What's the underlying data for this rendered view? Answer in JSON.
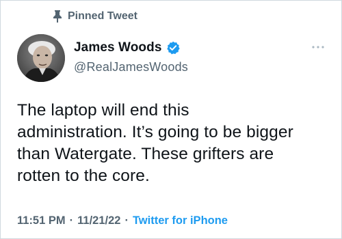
{
  "pinned": {
    "label": "Pinned Tweet",
    "icon": "pin-icon"
  },
  "author": {
    "display_name": "James Woods",
    "handle": "@RealJamesWoods",
    "verified": true,
    "verified_color": "#1d9bf0",
    "avatar": "avatar-photo"
  },
  "tweet": {
    "lines": [
      "The laptop will end this",
      "administration. It’s going to be bigger",
      "than Watergate. These grifters are",
      "rotten to the core."
    ]
  },
  "meta": {
    "time": "11:51 PM",
    "separator": "·",
    "date": "11/21/22",
    "source": "Twitter for iPhone"
  },
  "colors": {
    "text": "#0f1419",
    "secondary": "#536471",
    "accent": "#1d9bf0"
  }
}
